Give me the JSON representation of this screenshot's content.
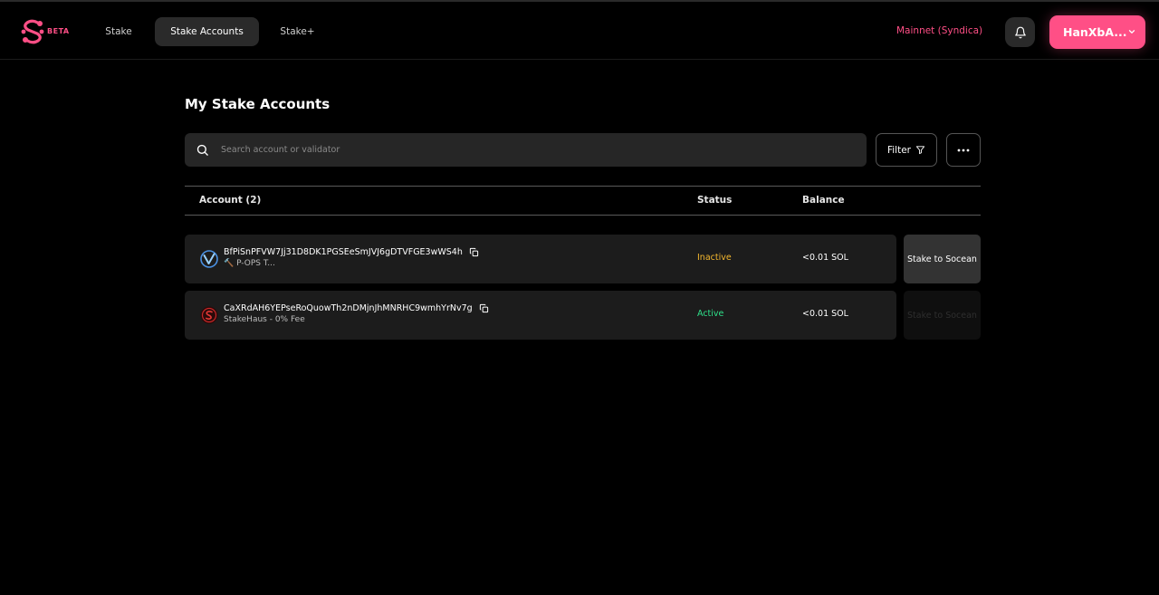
{
  "header": {
    "beta_badge": "BETA",
    "tabs": [
      {
        "label": "Stake"
      },
      {
        "label": "Stake Accounts"
      },
      {
        "label": "Stake+"
      }
    ],
    "network": "Mainnet (Syndica)",
    "wallet_label": "HanXbA..."
  },
  "main": {
    "title": "My Stake Accounts",
    "search_placeholder": "Search account or validator",
    "filter_label": "Filter",
    "table": {
      "headers": {
        "account": "Account (2)",
        "status": "Status",
        "balance": "Balance"
      },
      "rows": [
        {
          "address": "BfPiSnPFVW7Jj31D8DK1PGSEeSmJVJ6gDTVFGE3wWS4h",
          "validator": "🔨 P-OPS T...",
          "status": "Inactive",
          "balance": "<0.01 SOL",
          "action": "Stake to Socean"
        },
        {
          "address": "CaXRdAH6YEPseRoQuowTh2nDMjnJhMNRHC9wmhYrNv7g",
          "validator": "StakeHaus - 0% Fee",
          "status": "Active",
          "balance": "<0.01 SOL",
          "action": "Stake to Socean"
        }
      ]
    }
  },
  "colors": {
    "accent": "#ff4f86",
    "inactive": "#f5b82e",
    "active": "#2ee08a"
  }
}
